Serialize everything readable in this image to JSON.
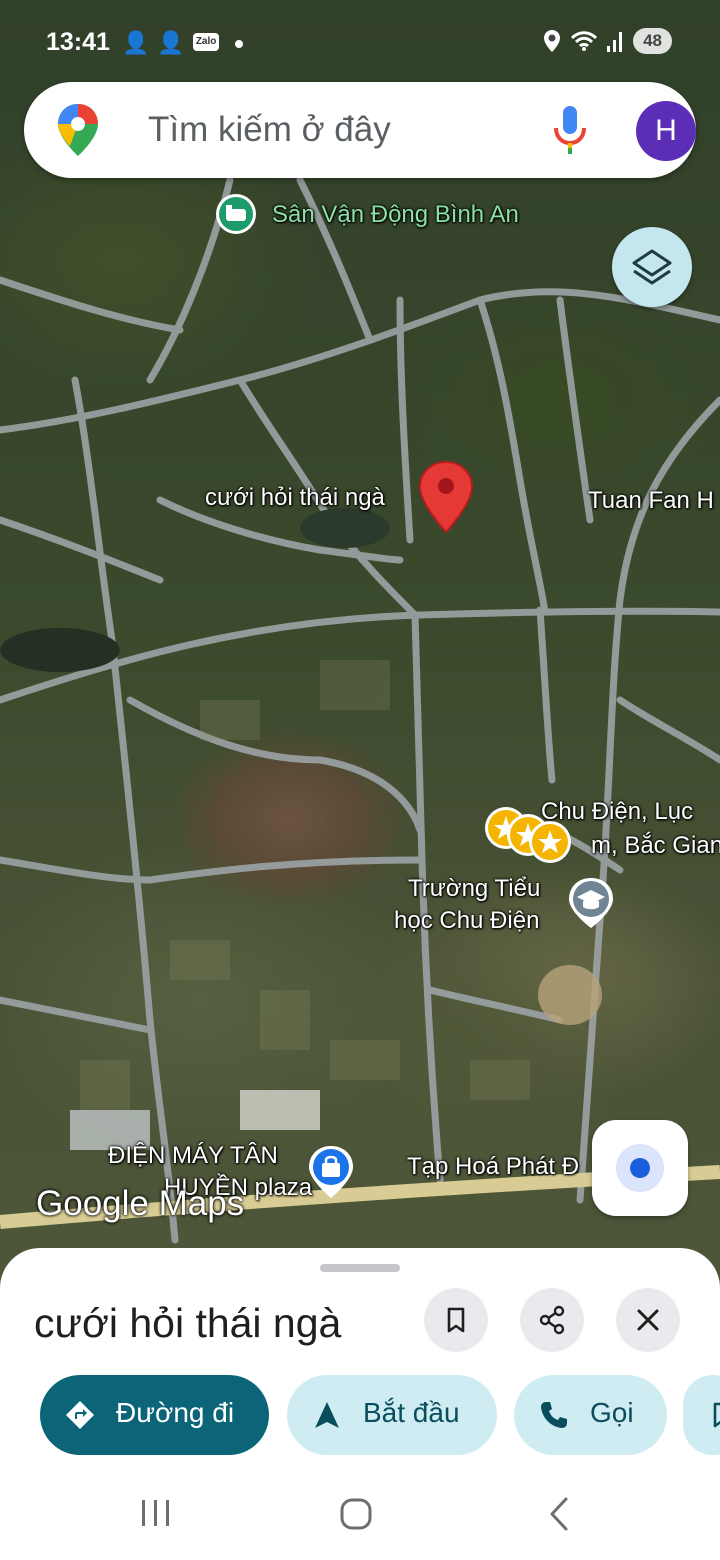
{
  "status_bar": {
    "time": "13:41",
    "notif_zalo": "Zalo",
    "battery": "48"
  },
  "search": {
    "placeholder": "Tìm kiếm ở đây",
    "avatar_initial": "H"
  },
  "map": {
    "labels": {
      "stadium": "Sân Vận Động Bình An",
      "pin_place": "cưới hỏi thái ngà",
      "tuan_fan": "Tuan Fan H",
      "chu_dien_1": "Chu Điện, Lục",
      "chu_dien_2": "m, Bắc Gian",
      "school_1": "Trường Tiểu",
      "school_2": "học Chu Điện",
      "electronics_1": "ĐIỆN MÁY TÂN",
      "electronics_2": "HUYỀN plaza",
      "grocery": "Tạp Hoá Phát Đ"
    },
    "logo": "Google Maps",
    "icons": [
      "map-layers-icon",
      "my-location-icon",
      "red-pin-icon",
      "stadium-icon",
      "school-icon",
      "shopping-bag-icon",
      "star-icon"
    ]
  },
  "place": {
    "title": "cưới hỏi thái ngà",
    "actions": {
      "directions": "Đường đi",
      "start": "Bắt đầu",
      "call": "Gọi"
    }
  },
  "colors": {
    "primary_button": "#0b6477",
    "secondary_button": "#cfecf3",
    "avatar": "#5c2eb8",
    "pin": "#e53935"
  }
}
